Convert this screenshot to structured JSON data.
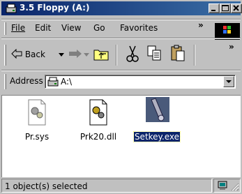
{
  "window": {
    "title": "3.5 Floppy (A:)",
    "title_bar_color": "#0a246a",
    "caption_buttons": [
      "minimize",
      "maximize",
      "close"
    ]
  },
  "menu": {
    "items": [
      "File",
      "Edit",
      "View",
      "Go",
      "Favorites"
    ],
    "overflow": "»"
  },
  "toolbar": {
    "back_label": "Back",
    "overflow": "»"
  },
  "address": {
    "label": "Address",
    "value": "A:\\"
  },
  "files": [
    {
      "name": "Pr.sys",
      "icon": "system-file-icon",
      "selected": false
    },
    {
      "name": "Prk20.dll",
      "icon": "dll-file-icon",
      "selected": false
    },
    {
      "name": "Setkey.exe",
      "icon": "setkey-exe-icon",
      "selected": true
    }
  ],
  "status": {
    "text": "1 object(s) selected"
  },
  "colors": {
    "selection": "#0a246a",
    "window_face": "#c0c0c0"
  }
}
